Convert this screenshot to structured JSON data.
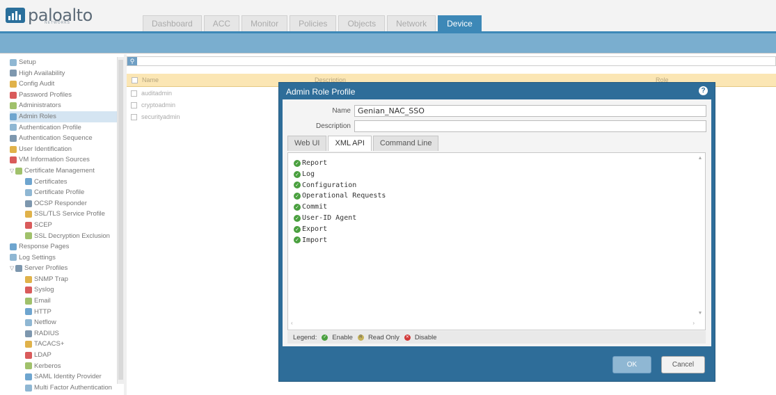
{
  "app": {
    "logo_text": "paloalto",
    "logo_sub": "NETWORKS"
  },
  "tabs": [
    {
      "label": "Dashboard"
    },
    {
      "label": "ACC"
    },
    {
      "label": "Monitor"
    },
    {
      "label": "Policies"
    },
    {
      "label": "Objects"
    },
    {
      "label": "Network"
    },
    {
      "label": "Device",
      "active": true
    }
  ],
  "sidebar": {
    "items": [
      {
        "label": "Setup",
        "icon": "setup-icon",
        "level": 1
      },
      {
        "label": "High Availability",
        "icon": "ha-icon",
        "level": 1
      },
      {
        "label": "Config Audit",
        "icon": "audit-icon",
        "level": 1
      },
      {
        "label": "Password Profiles",
        "icon": "password-icon",
        "level": 1
      },
      {
        "label": "Administrators",
        "icon": "admin-icon",
        "level": 1
      },
      {
        "label": "Admin Roles",
        "icon": "role-icon",
        "level": 1,
        "selected": true
      },
      {
        "label": "Authentication Profile",
        "icon": "auth-icon",
        "level": 1
      },
      {
        "label": "Authentication Sequence",
        "icon": "auth-seq-icon",
        "level": 1
      },
      {
        "label": "User Identification",
        "icon": "user-id-icon",
        "level": 1
      },
      {
        "label": "VM Information Sources",
        "icon": "vm-icon",
        "level": 1
      },
      {
        "label": "Certificate Management",
        "icon": "cert-mgmt-icon",
        "level": 1,
        "expanded": true
      },
      {
        "label": "Certificates",
        "icon": "cert-icon",
        "level": 2
      },
      {
        "label": "Certificate Profile",
        "icon": "cert-profile-icon",
        "level": 2
      },
      {
        "label": "OCSP Responder",
        "icon": "ocsp-icon",
        "level": 2
      },
      {
        "label": "SSL/TLS Service Profile",
        "icon": "ssl-icon",
        "level": 2
      },
      {
        "label": "SCEP",
        "icon": "scep-icon",
        "level": 2
      },
      {
        "label": "SSL Decryption Exclusion",
        "icon": "lock-icon",
        "level": 2
      },
      {
        "label": "Response Pages",
        "icon": "response-icon",
        "level": 1
      },
      {
        "label": "Log Settings",
        "icon": "log-icon",
        "level": 1
      },
      {
        "label": "Server Profiles",
        "icon": "server-icon",
        "level": 1,
        "expanded": true
      },
      {
        "label": "SNMP Trap",
        "icon": "snmp-icon",
        "level": 2
      },
      {
        "label": "Syslog",
        "icon": "syslog-icon",
        "level": 2
      },
      {
        "label": "Email",
        "icon": "email-icon",
        "level": 2
      },
      {
        "label": "HTTP",
        "icon": "http-icon",
        "level": 2
      },
      {
        "label": "Netflow",
        "icon": "netflow-icon",
        "level": 2
      },
      {
        "label": "RADIUS",
        "icon": "radius-icon",
        "level": 2
      },
      {
        "label": "TACACS+",
        "icon": "tacacs-icon",
        "level": 2
      },
      {
        "label": "LDAP",
        "icon": "ldap-icon",
        "level": 2
      },
      {
        "label": "Kerberos",
        "icon": "kerberos-icon",
        "level": 2
      },
      {
        "label": "SAML Identity Provider",
        "icon": "saml-icon",
        "level": 2
      },
      {
        "label": "Multi Factor Authentication",
        "icon": "mfa-icon",
        "level": 2
      }
    ]
  },
  "grid": {
    "columns": [
      "Name",
      "Description",
      "Role"
    ],
    "rows": [
      "auditadmin",
      "cryptoadmin",
      "securityadmin"
    ]
  },
  "modal": {
    "title": "Admin Role Profile",
    "name_label": "Name",
    "name_value": "Genian_NAC_SSO",
    "description_label": "Description",
    "description_value": "",
    "tabs": [
      {
        "label": "Web UI"
      },
      {
        "label": "XML API",
        "active": true
      },
      {
        "label": "Command Line"
      }
    ],
    "permissions": [
      "Report",
      "Log",
      "Configuration",
      "Operational Requests",
      "Commit",
      "User-ID Agent",
      "Export",
      "Import"
    ],
    "legend": {
      "label": "Legend:",
      "enable": "Enable",
      "read_only": "Read Only",
      "disable": "Disable"
    },
    "ok_label": "OK",
    "cancel_label": "Cancel"
  },
  "colors": {
    "accent": "#3d88b7",
    "modal_bg": "#2e6d99",
    "enable": "#4aa03f",
    "disable": "#d23a3a",
    "grid_header": "#fbe6b4"
  }
}
